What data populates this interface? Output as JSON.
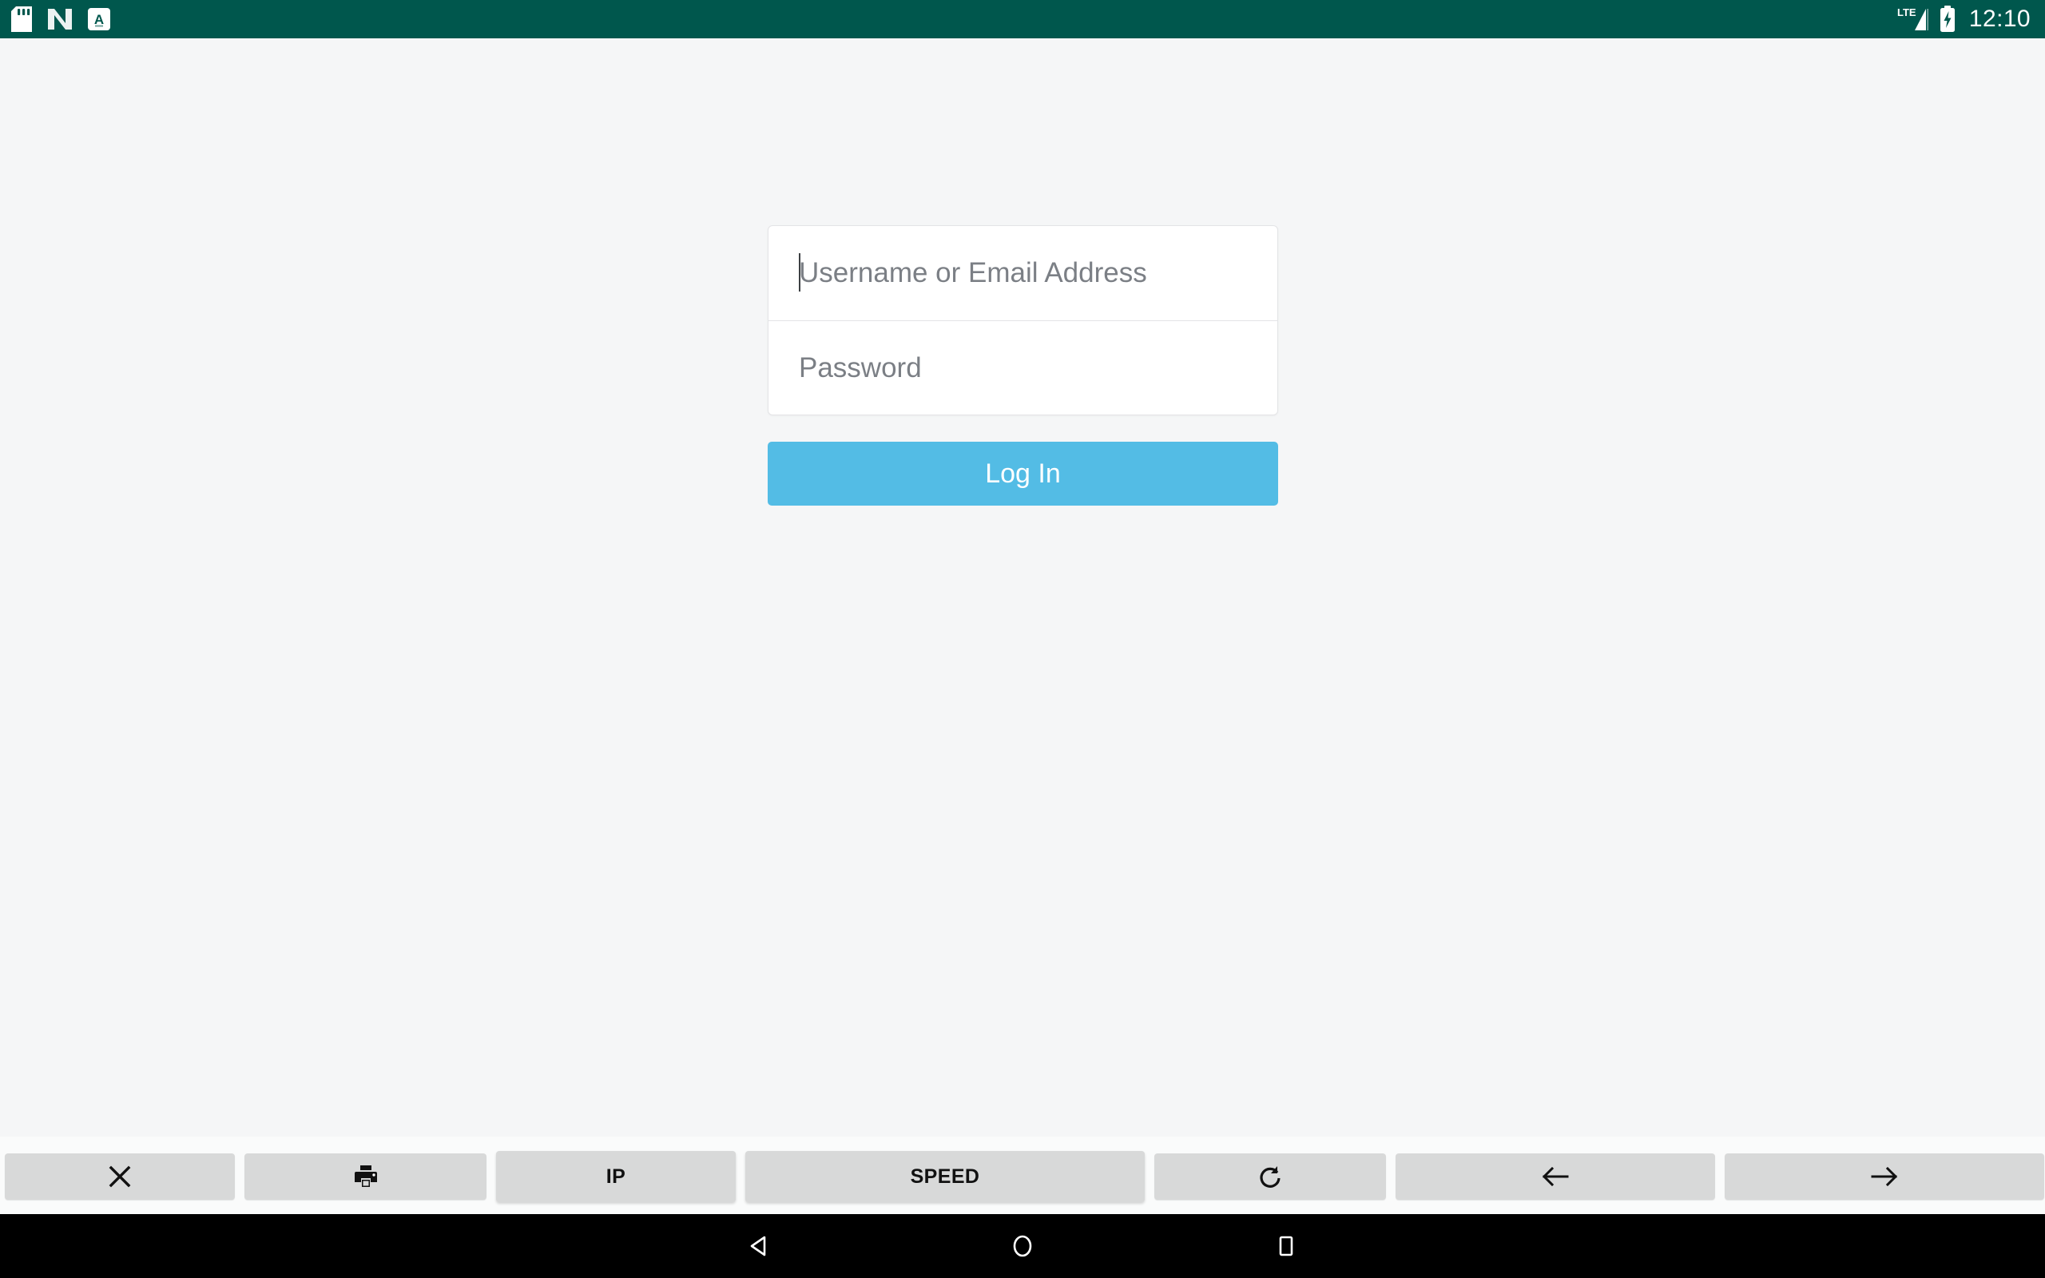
{
  "status_bar": {
    "background_color": "#00574d",
    "left_icons": [
      {
        "name": "sd-card-icon",
        "label": "SD card"
      },
      {
        "name": "android-nougat-icon",
        "label": "N"
      },
      {
        "name": "app-badge-a-icon",
        "label": "A"
      }
    ],
    "network_label": "LTE",
    "signal": {
      "name": "signal-bars-icon",
      "bars_filled": 2,
      "bars_total": 4
    },
    "battery": {
      "name": "battery-charging-icon",
      "charging": true
    },
    "clock": "12:10"
  },
  "login_form": {
    "username_field": {
      "placeholder": "Username or Email Address",
      "value": "",
      "focused": true
    },
    "password_field": {
      "placeholder": "Password",
      "value": "",
      "focused": false
    },
    "submit_label": "Log In",
    "submit_color": "#53bce5"
  },
  "toolbar": {
    "background_color": "#fafbfb",
    "button_color": "#d8d9d9",
    "buttons": [
      {
        "name": "close-button",
        "icon": "close-icon",
        "label": ""
      },
      {
        "name": "print-button",
        "icon": "print-icon",
        "label": ""
      },
      {
        "name": "ip-button",
        "icon": "",
        "label": "IP"
      },
      {
        "name": "speed-button",
        "icon": "",
        "label": "SPEED"
      },
      {
        "name": "refresh-button",
        "icon": "refresh-icon",
        "label": ""
      },
      {
        "name": "back-button",
        "icon": "arrow-left-icon",
        "label": ""
      },
      {
        "name": "forward-button",
        "icon": "arrow-right-icon",
        "label": ""
      }
    ]
  },
  "nav_bar": {
    "background_color": "#000000",
    "buttons": [
      {
        "name": "android-back-button",
        "icon": "triangle-left-icon"
      },
      {
        "name": "android-home-button",
        "icon": "circle-icon"
      },
      {
        "name": "android-recents-button",
        "icon": "square-icon"
      }
    ]
  }
}
